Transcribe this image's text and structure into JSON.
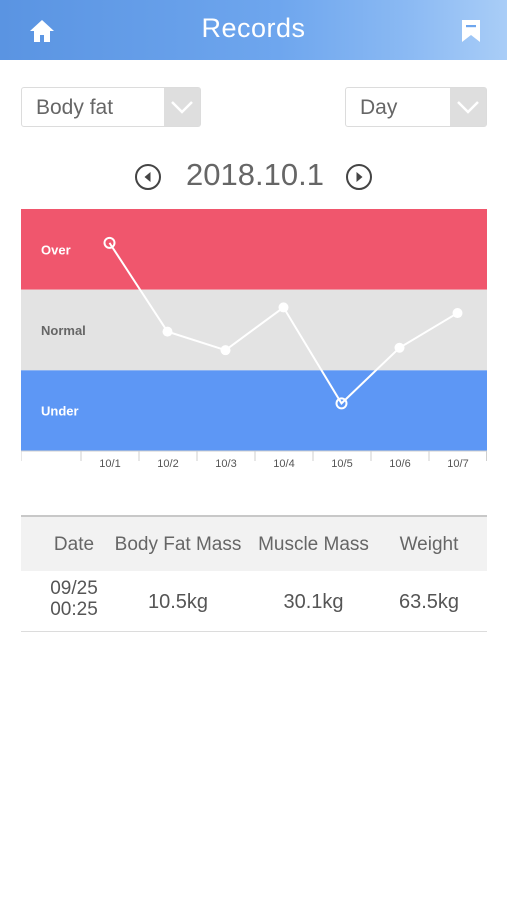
{
  "header": {
    "title": "Records",
    "home_icon": "home-icon",
    "bookmark_icon": "bookmark-icon"
  },
  "filters": {
    "metric": {
      "selected": "Body fat"
    },
    "period": {
      "selected": "Day"
    }
  },
  "date_nav": {
    "current": "2018.10.1"
  },
  "colors": {
    "over": "#f0566d",
    "normal": "#e3e3e3",
    "under": "#5d97f5",
    "header": "#6ea6ee"
  },
  "chart_data": {
    "type": "line",
    "categories": [
      "10/1",
      "10/2",
      "10/3",
      "10/4",
      "10/5",
      "10/6",
      "10/7"
    ],
    "bands": [
      {
        "label": "Over"
      },
      {
        "label": "Normal"
      },
      {
        "label": "Under"
      }
    ],
    "ylim": [
      0,
      3
    ],
    "values": [
      2.58,
      1.48,
      1.25,
      1.78,
      0.59,
      1.28,
      1.71
    ],
    "hollow_points": [
      0,
      4
    ]
  },
  "table": {
    "headers": [
      "Date",
      "Body Fat Mass",
      "Muscle Mass",
      "Weight"
    ],
    "rows": [
      {
        "date_line1": "09/25",
        "date_line2": "00:25",
        "fat": "10.5kg",
        "muscle": "30.1kg",
        "weight": "63.5kg"
      }
    ]
  }
}
